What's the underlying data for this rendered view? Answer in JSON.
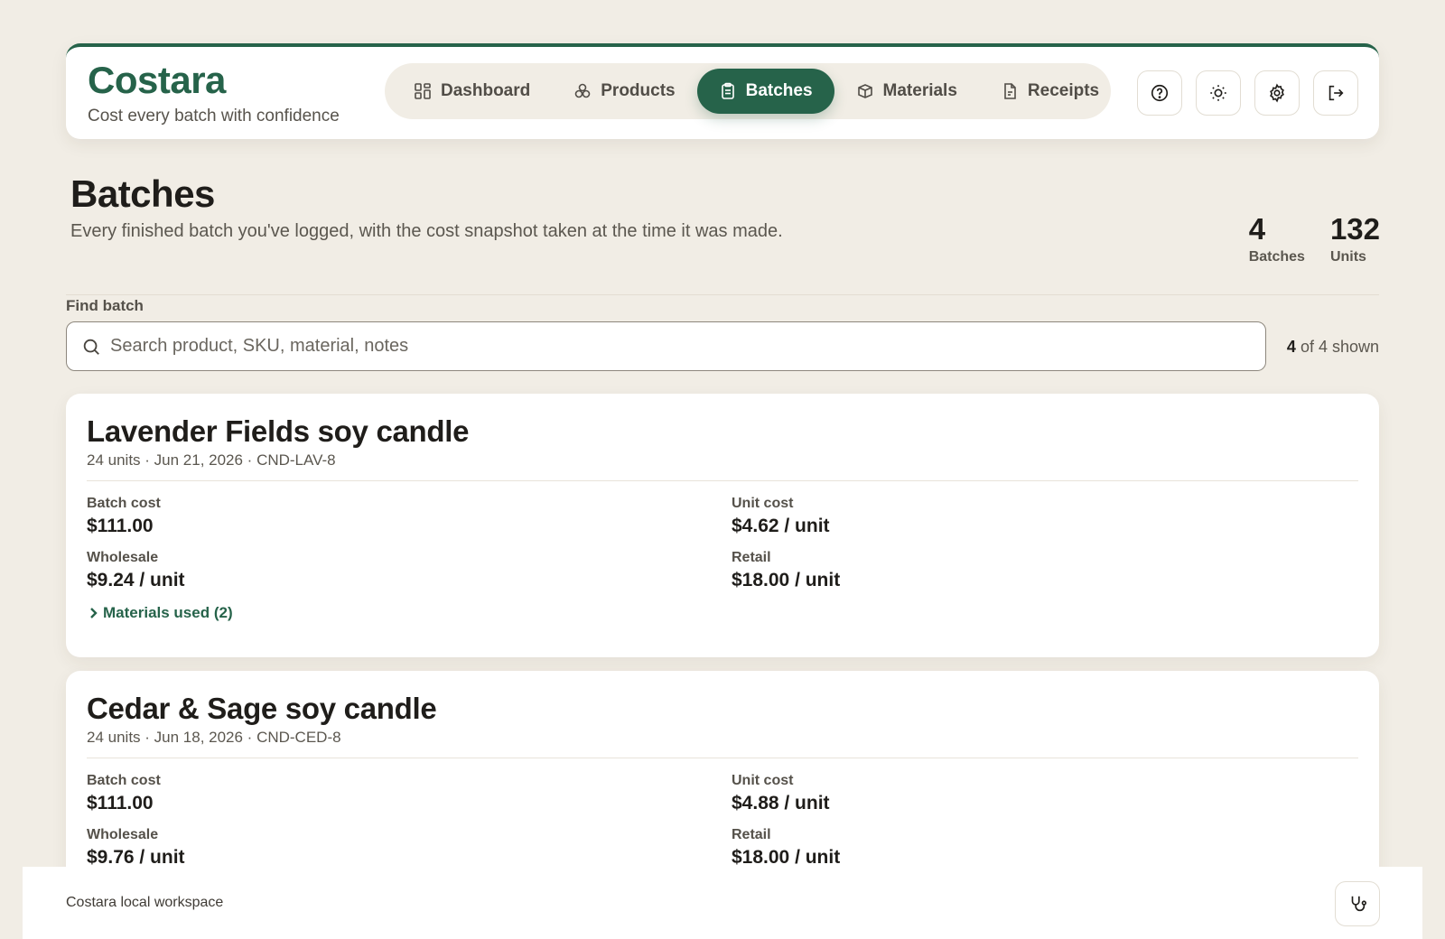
{
  "brand": {
    "title": "Costara",
    "tagline": "Cost every batch with confidence"
  },
  "nav": [
    {
      "label": "Dashboard",
      "icon": "dashboard-icon",
      "active": false
    },
    {
      "label": "Products",
      "icon": "products-icon",
      "active": false
    },
    {
      "label": "Batches",
      "icon": "clipboard-icon",
      "active": true
    },
    {
      "label": "Materials",
      "icon": "materials-icon",
      "active": false
    },
    {
      "label": "Receipts",
      "icon": "receipt-icon",
      "active": false
    }
  ],
  "actions": [
    "help-icon",
    "theme-icon",
    "settings-icon",
    "logout-icon"
  ],
  "page": {
    "title": "Batches",
    "description": "Every finished batch you've logged, with the cost snapshot taken at the time it was made.",
    "stats": [
      {
        "value": "4",
        "label": "Batches"
      },
      {
        "value": "132",
        "label": "Units"
      }
    ]
  },
  "search": {
    "label": "Find batch",
    "placeholder": "Search product, SKU, material, notes",
    "value": "",
    "shown_count": "4",
    "shown_suffix": "of 4 shown"
  },
  "batches": [
    {
      "title": "Lavender Fields soy candle",
      "meta": "24 units · Jun 21, 2026 · CND-LAV-8",
      "batch_cost_label": "Batch cost",
      "batch_cost": "$111.00",
      "unit_cost_label": "Unit cost",
      "unit_cost": "$4.62 / unit",
      "wholesale_label": "Wholesale",
      "wholesale": "$9.24 / unit",
      "retail_label": "Retail",
      "retail": "$18.00 / unit",
      "materials_label": "Materials used (2)"
    },
    {
      "title": "Cedar & Sage soy candle",
      "meta": "24 units · Jun 18, 2026 · CND-CED-8",
      "batch_cost_label": "Batch cost",
      "batch_cost": "$111.00",
      "unit_cost_label": "Unit cost",
      "unit_cost": "$4.88 / unit",
      "wholesale_label": "Wholesale",
      "wholesale": "$9.76 / unit",
      "retail_label": "Retail",
      "retail": "$18.00 / unit"
    }
  ],
  "footer": {
    "text": "Costara local workspace",
    "icon": "stethoscope-icon"
  },
  "colors": {
    "accent": "#26634a",
    "background": "#f1ede5"
  }
}
